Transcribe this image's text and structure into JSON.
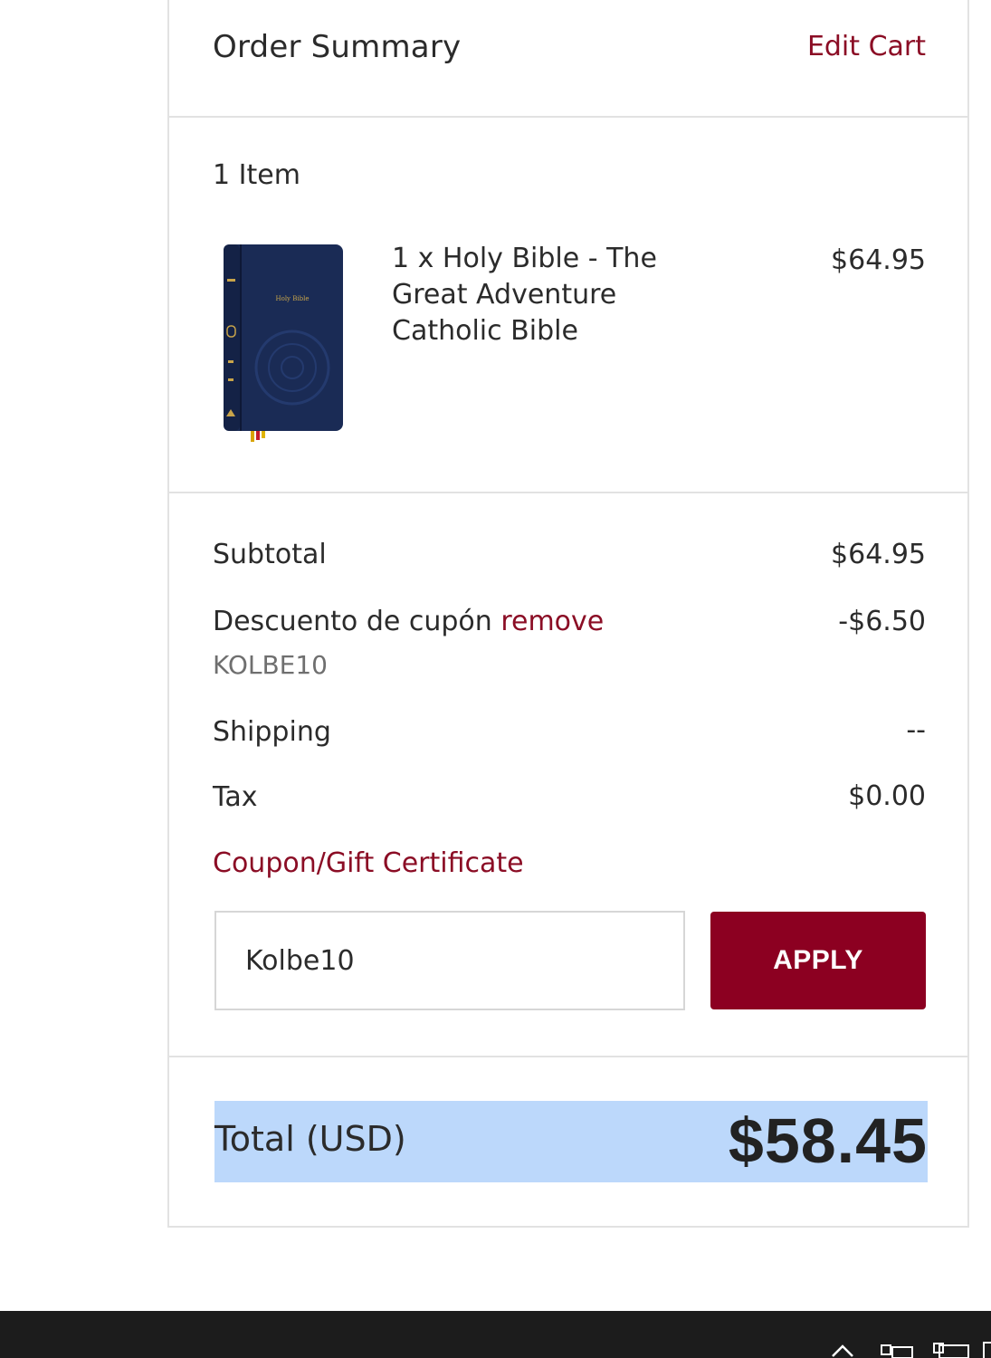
{
  "header": {
    "title": "Order Summary",
    "edit_cart": "Edit Cart"
  },
  "items": {
    "count_label": "1 Item",
    "list": [
      {
        "name": "1 x Holy Bible - The Great Adventure Catholic Bible",
        "price": "$64.95",
        "cover_text": "Holy Bible"
      }
    ]
  },
  "totals": {
    "subtotal_label": "Subtotal",
    "subtotal_value": "$64.95",
    "discount_label": "Descuento de cupón",
    "discount_remove": "remove",
    "discount_code": "KOLBE10",
    "discount_value": "-$6.50",
    "shipping_label": "Shipping",
    "shipping_value": "--",
    "tax_label": "Tax",
    "tax_value": "$0.00"
  },
  "coupon": {
    "toggle_label": "Coupon/Gift Certificate",
    "input_value": "Kolbe10",
    "apply_label": "APPLY"
  },
  "grand_total": {
    "label": "Total (USD)",
    "value": "$58.45"
  },
  "taskbar": {
    "icons": [
      "chevron-up-icon",
      "network-icon",
      "display-icon"
    ]
  },
  "colors": {
    "accent": "#8b0d25",
    "button": "#8c0021",
    "highlight": "#bcd8fb",
    "border": "#e2e2e2"
  }
}
